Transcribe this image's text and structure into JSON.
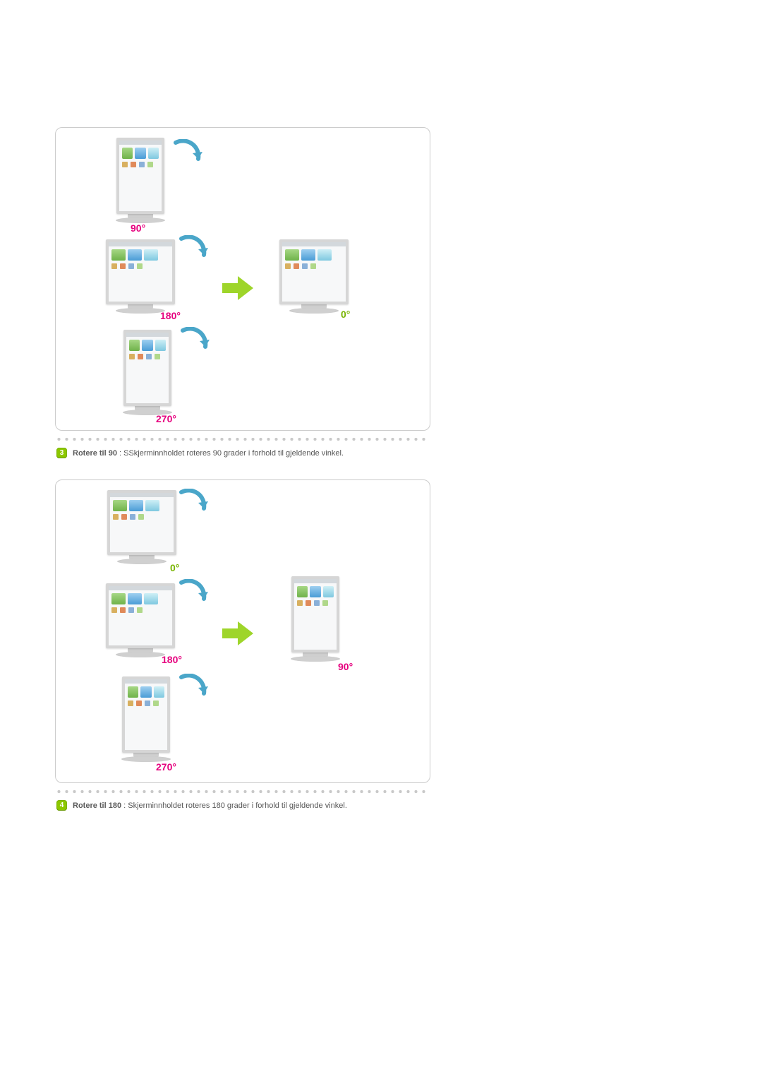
{
  "sections": [
    {
      "badge": "3",
      "title": "Rotere til 90",
      "desc": " : SSkjerminnholdet roteres 90 grader i forhold til gjeldende vinkel.",
      "diagram": {
        "left_labels": [
          "90°",
          "180°",
          "270°"
        ],
        "right_label": "0°",
        "left_orientations": [
          "portrait",
          "landscape",
          "portrait"
        ],
        "right_orientation": "landscape"
      }
    },
    {
      "badge": "4",
      "title": "Rotere til 180",
      "desc": " : Skjerminnholdet roteres 180 grader i forhold til gjeldende vinkel.",
      "diagram": {
        "left_labels": [
          "0°",
          "180°",
          "270°"
        ],
        "right_label": "90°",
        "left_orientations": [
          "landscape",
          "landscape",
          "portrait"
        ],
        "right_orientation": "portrait"
      }
    }
  ]
}
